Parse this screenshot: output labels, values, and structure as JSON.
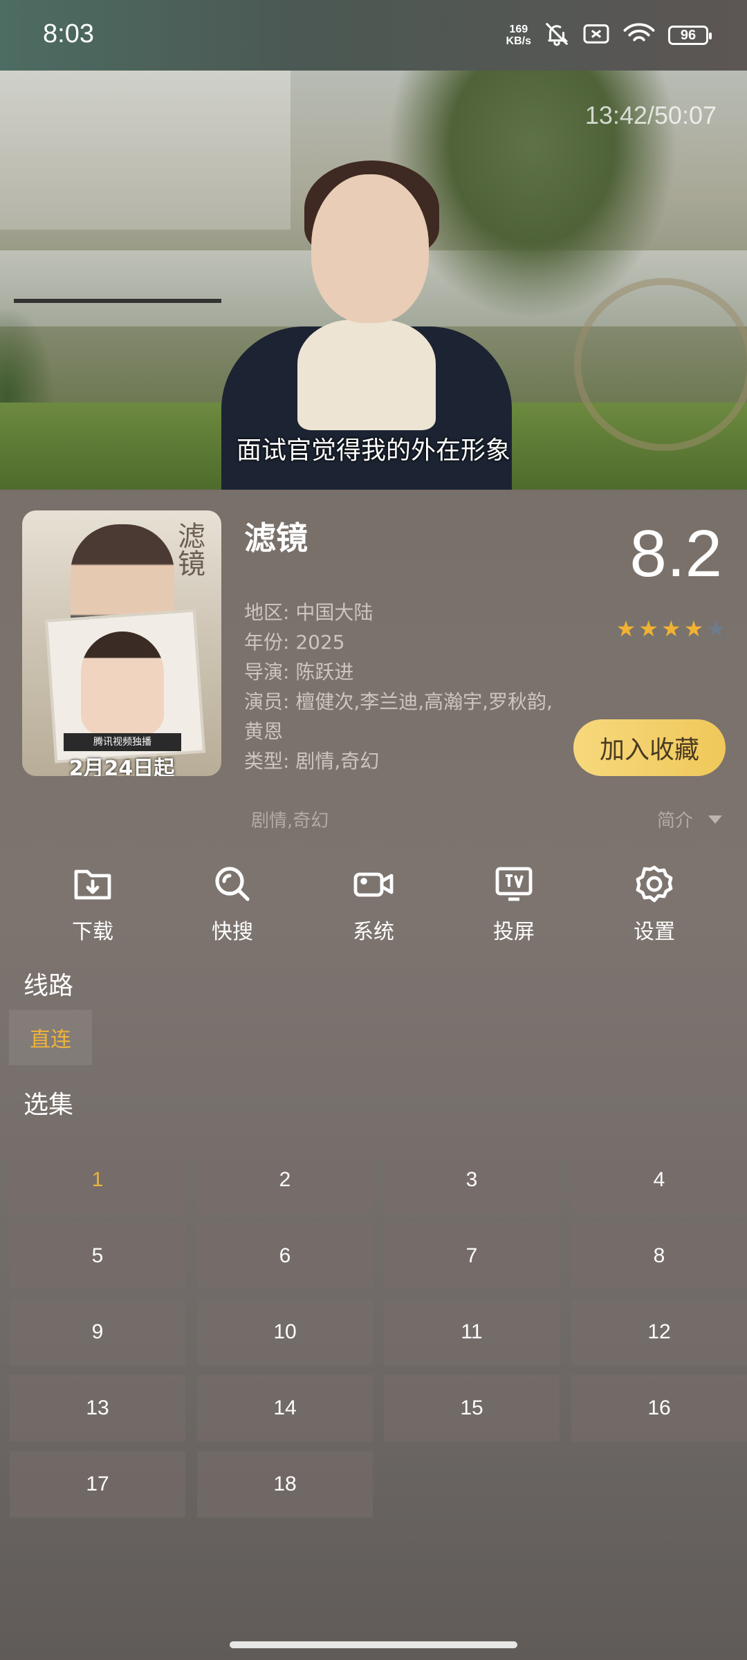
{
  "status_bar": {
    "time": "8:03",
    "net_speed_value": "169",
    "net_speed_unit": "KB/s",
    "battery": "96"
  },
  "player": {
    "time_display": "13:42/50:07",
    "subtitle": "面试官觉得我的外在形象"
  },
  "poster": {
    "title_text": "滤镜",
    "tag_text": "腾讯视频独播",
    "date_text": "2月24日起"
  },
  "detail": {
    "title": "滤镜",
    "region": "地区: 中国大陆",
    "year": "年份: 2025",
    "director": "导演: 陈跃进",
    "cast": "演员: 檀健次,李兰迪,高瀚宇,罗秋韵,黄恩",
    "genre": "类型: 剧情,奇幻",
    "score": "8.2",
    "rating_stars": 4,
    "rating_max": 5,
    "favorite_button": "加入收藏",
    "genre_line": "剧情,奇幻",
    "intro_label": "简介"
  },
  "actions": [
    {
      "label": "下载",
      "icon": "download-folder-icon"
    },
    {
      "label": "快搜",
      "icon": "search-icon"
    },
    {
      "label": "系统",
      "icon": "video-camera-icon"
    },
    {
      "label": "投屏",
      "icon": "tv-cast-icon"
    },
    {
      "label": "设置",
      "icon": "gear-icon"
    }
  ],
  "route": {
    "label": "线路",
    "selected": "直连"
  },
  "episodes": {
    "label": "选集",
    "selected": "1",
    "items": [
      "1",
      "2",
      "3",
      "4",
      "5",
      "6",
      "7",
      "8",
      "9",
      "10",
      "11",
      "12",
      "13",
      "14",
      "15",
      "16",
      "17",
      "18"
    ]
  },
  "colors": {
    "accent": "#f0b33a",
    "favorite_bg": "#f2cd63",
    "star_on": "#f1b232",
    "star_off": "#6f7c8c"
  }
}
